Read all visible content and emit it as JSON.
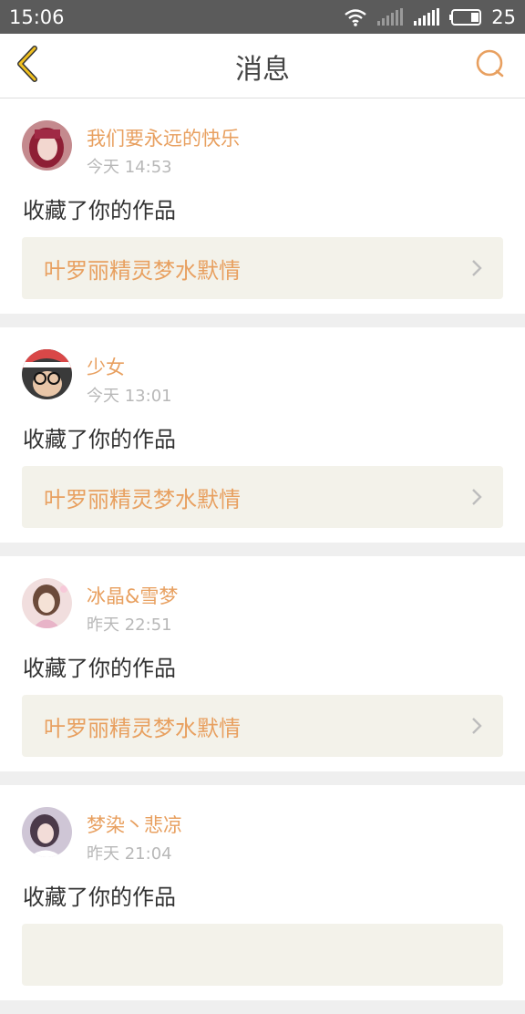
{
  "status": {
    "time": "15:06",
    "battery": "25"
  },
  "nav": {
    "title": "消息"
  },
  "messages": [
    {
      "user": "我们要永远的快乐",
      "time": "今天 14:53",
      "action": "收藏了你的作品",
      "work": "叶罗丽精灵梦水默情"
    },
    {
      "user": "少女",
      "time": "今天 13:01",
      "action": "收藏了你的作品",
      "work": "叶罗丽精灵梦水默情"
    },
    {
      "user": "冰晶&雪梦",
      "time": "昨天 22:51",
      "action": "收藏了你的作品",
      "work": "叶罗丽精灵梦水默情"
    },
    {
      "user": "梦染丶悲凉",
      "time": "昨天 21:04",
      "action": "收藏了你的作品",
      "work": ""
    }
  ],
  "colors": {
    "accent": "#e8a060",
    "back_arrow": "#f0c020"
  }
}
